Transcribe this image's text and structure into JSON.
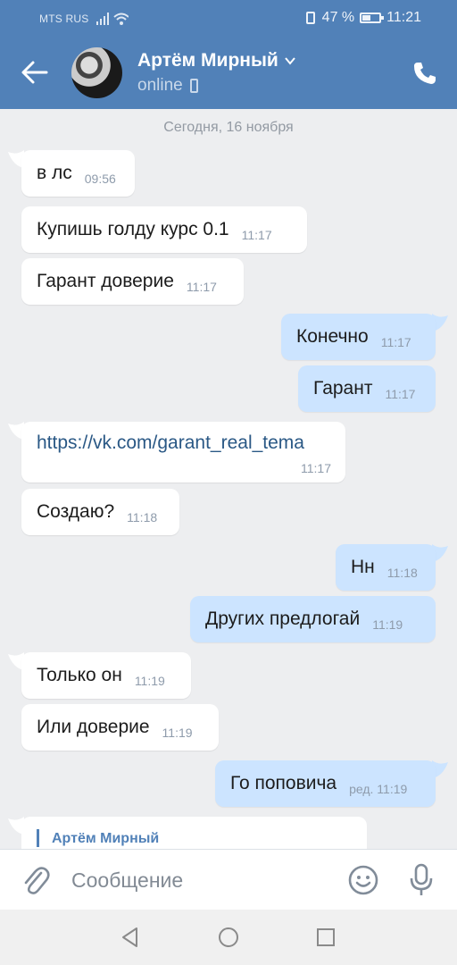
{
  "status_bar": {
    "carrier": "MTS RUS",
    "battery": "47 %",
    "time": "11:21"
  },
  "header": {
    "name": "Артём Мирный",
    "status": "online"
  },
  "chat": {
    "date_divider": "Сегодня, 16 ноября",
    "messages": [
      {
        "dir": "in",
        "text": "в лс",
        "time": "09:56"
      },
      {
        "dir": "in",
        "text": "Купишь голду курс 0.1",
        "time": "11:17"
      },
      {
        "dir": "in",
        "text": "Гарант доверие",
        "time": "11:17"
      },
      {
        "dir": "out",
        "text": "Конечно",
        "time": "11:17"
      },
      {
        "dir": "out",
        "text": "Гарант",
        "time": "11:17"
      },
      {
        "dir": "in",
        "text": "https://vk.com/garant_real_tema",
        "time": "11:17"
      },
      {
        "dir": "in",
        "text": "Создаю?",
        "time": "11:18"
      },
      {
        "dir": "out",
        "text": "Нн",
        "time": "11:18"
      },
      {
        "dir": "out",
        "text": "Других предлогай",
        "time": "11:19"
      },
      {
        "dir": "in",
        "text": "Только он",
        "time": "11:19"
      },
      {
        "dir": "in",
        "text": "Или доверие",
        "time": "11:19"
      },
      {
        "dir": "out",
        "text": "Го поповича",
        "time": "ред. 11:19"
      }
    ],
    "reply_preview_author": "Артём Мирный"
  },
  "composer": {
    "placeholder": "Сообщение"
  },
  "colors": {
    "header_bg": "#5181b8",
    "chat_bg": "#edeef0",
    "outgoing_bubble": "#cce4ff",
    "incoming_bubble": "#ffffff",
    "link": "#2a5885"
  },
  "icons": [
    "back-arrow-icon",
    "chevron-down-icon",
    "phone-icon",
    "paperclip-icon",
    "emoji-icon",
    "microphone-icon",
    "nav-back-icon",
    "nav-home-icon",
    "nav-recents-icon"
  ]
}
